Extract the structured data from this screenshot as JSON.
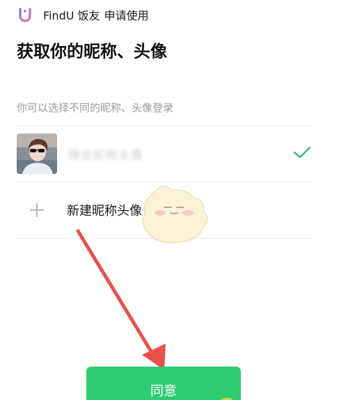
{
  "header": {
    "app_name": "FindU 饭友",
    "request_label": "申请使用"
  },
  "title": "获取你的昵称、头像",
  "subtitle": "你可以选择不同的昵称、头像登录",
  "options": {
    "current_profile": {
      "name": "微信昵称头像",
      "selected": true
    },
    "new_profile": {
      "label": "新建昵称头像"
    }
  },
  "agree_button": {
    "label": "同意"
  },
  "colors": {
    "accent_green": "#2ecc71",
    "check_green": "#2aae67",
    "arrow_red": "#e8504a",
    "logo_gradient_start": "#7b6cf6",
    "logo_gradient_end": "#f06aa8"
  },
  "icons": {
    "logo": "findu-logo-icon",
    "check": "checkmark-icon",
    "plus": "plus-icon"
  }
}
